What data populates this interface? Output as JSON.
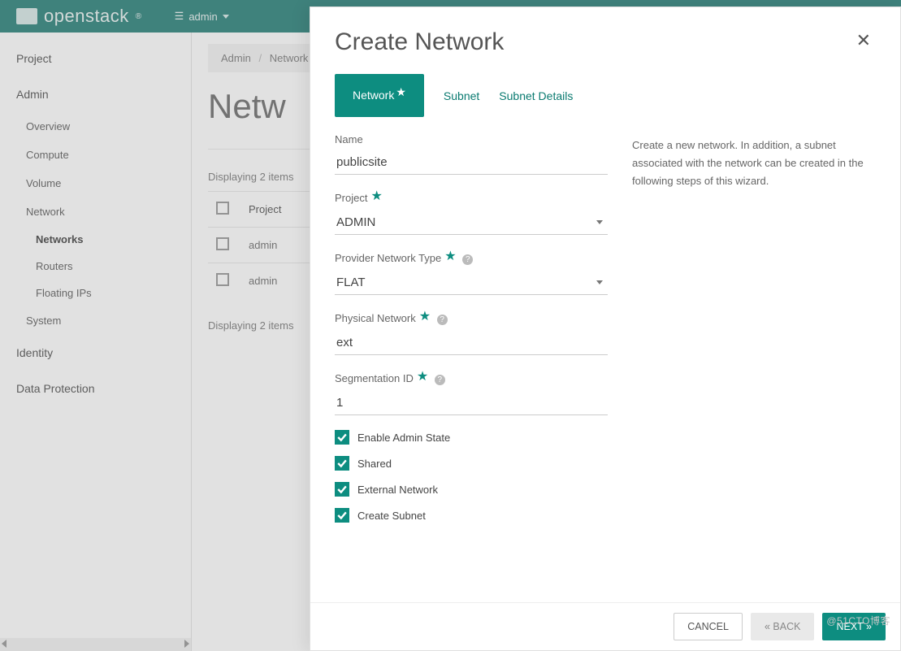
{
  "topbar": {
    "brand": "openstack",
    "user_label": "admin"
  },
  "sidebar": {
    "project": "Project",
    "admin": "Admin",
    "overview": "Overview",
    "compute": "Compute",
    "volume": "Volume",
    "network": "Network",
    "networks": "Networks",
    "routers": "Routers",
    "floating_ips": "Floating IPs",
    "system": "System",
    "identity": "Identity",
    "data_protection": "Data Protection"
  },
  "breadcrumb": {
    "admin": "Admin",
    "network": "Network"
  },
  "page": {
    "title": "Netw",
    "displaying": "Displaying 2 items"
  },
  "table": {
    "header_project": "Project",
    "rows": [
      {
        "project": "admin"
      },
      {
        "project": "admin"
      }
    ]
  },
  "modal": {
    "title": "Create Network",
    "tabs": {
      "network": "Network",
      "subnet": "Subnet",
      "subnet_details": "Subnet Details"
    },
    "help_text": "Create a new network. In addition, a subnet associated with the network can be created in the following steps of this wizard.",
    "fields": {
      "name_label": "Name",
      "name_value": "publicsite",
      "project_label": "Project",
      "project_value": "ADMIN",
      "provider_type_label": "Provider Network Type",
      "provider_type_value": "FLAT",
      "physical_network_label": "Physical Network",
      "physical_network_value": "ext",
      "segmentation_id_label": "Segmentation ID",
      "segmentation_id_value": "1"
    },
    "checks": {
      "enable_admin_state": "Enable Admin State",
      "shared": "Shared",
      "external_network": "External Network",
      "create_subnet": "Create Subnet"
    },
    "buttons": {
      "cancel": "CANCEL",
      "back": "«  BACK",
      "next": "NEXT  »"
    }
  },
  "watermark": "@51CTO博客"
}
